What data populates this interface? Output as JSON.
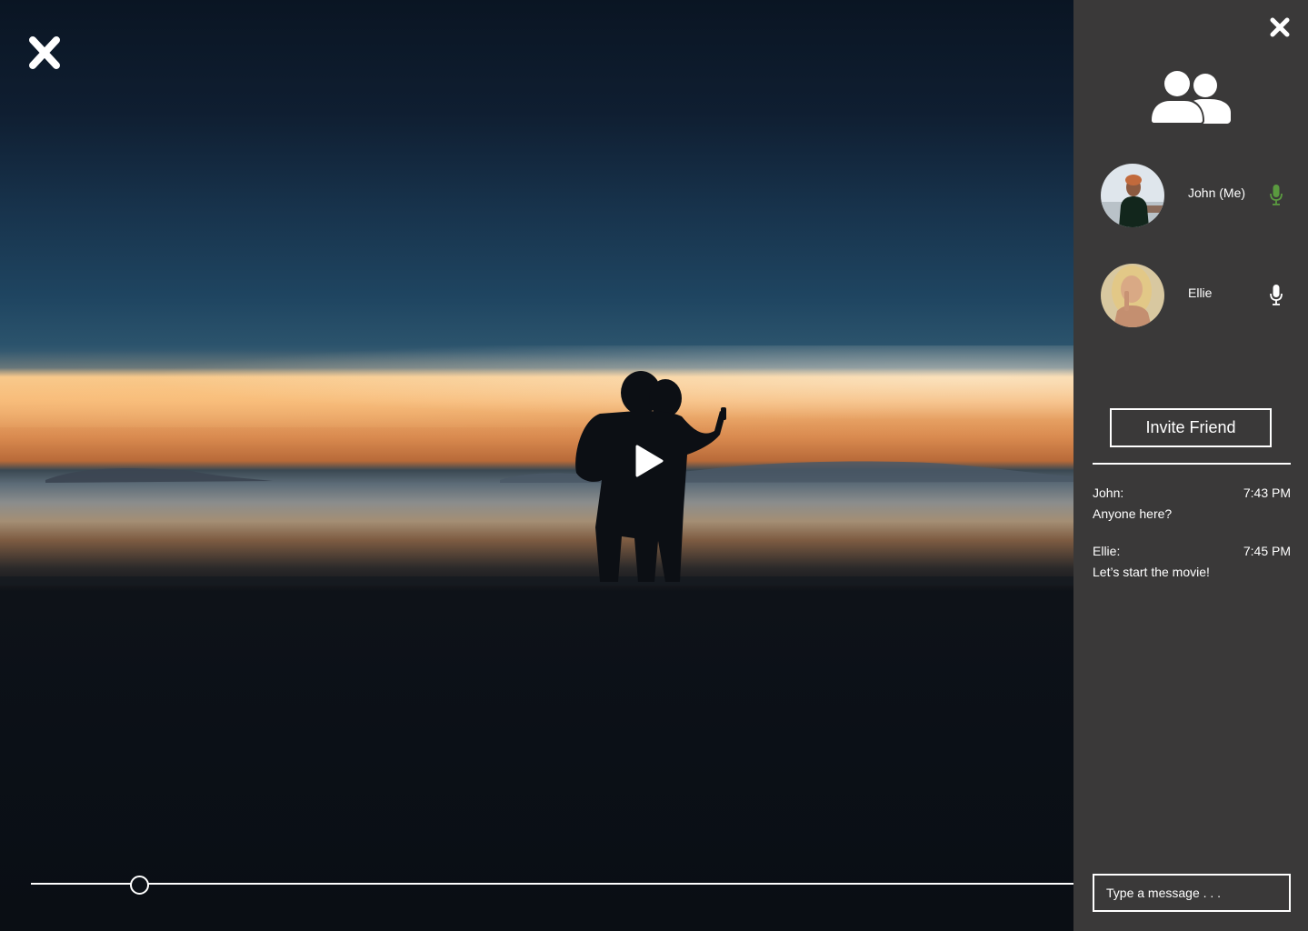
{
  "video": {
    "progress": 0.104
  },
  "icons": {
    "close_video": "close-icon",
    "play": "play-icon",
    "close_panel": "close-icon",
    "participants": "people-icon",
    "mic": "microphone-icon"
  },
  "participants": [
    {
      "name": "John (Me)",
      "mic_color": "#5a9a3f"
    },
    {
      "name": "Ellie",
      "mic_color": "#ffffff"
    }
  ],
  "invite": {
    "label": "Invite Friend"
  },
  "chat": {
    "messages": [
      {
        "sender": "John:",
        "time": "7:43 PM",
        "text": "Anyone here?"
      },
      {
        "sender": "Ellie:",
        "time": "7:45 PM",
        "text": "Let’s start the movie!"
      }
    ],
    "input_placeholder": "Type a message . . ."
  },
  "colors": {
    "panel_bg": "#3a3939",
    "mic_active": "#5a9a3f"
  }
}
